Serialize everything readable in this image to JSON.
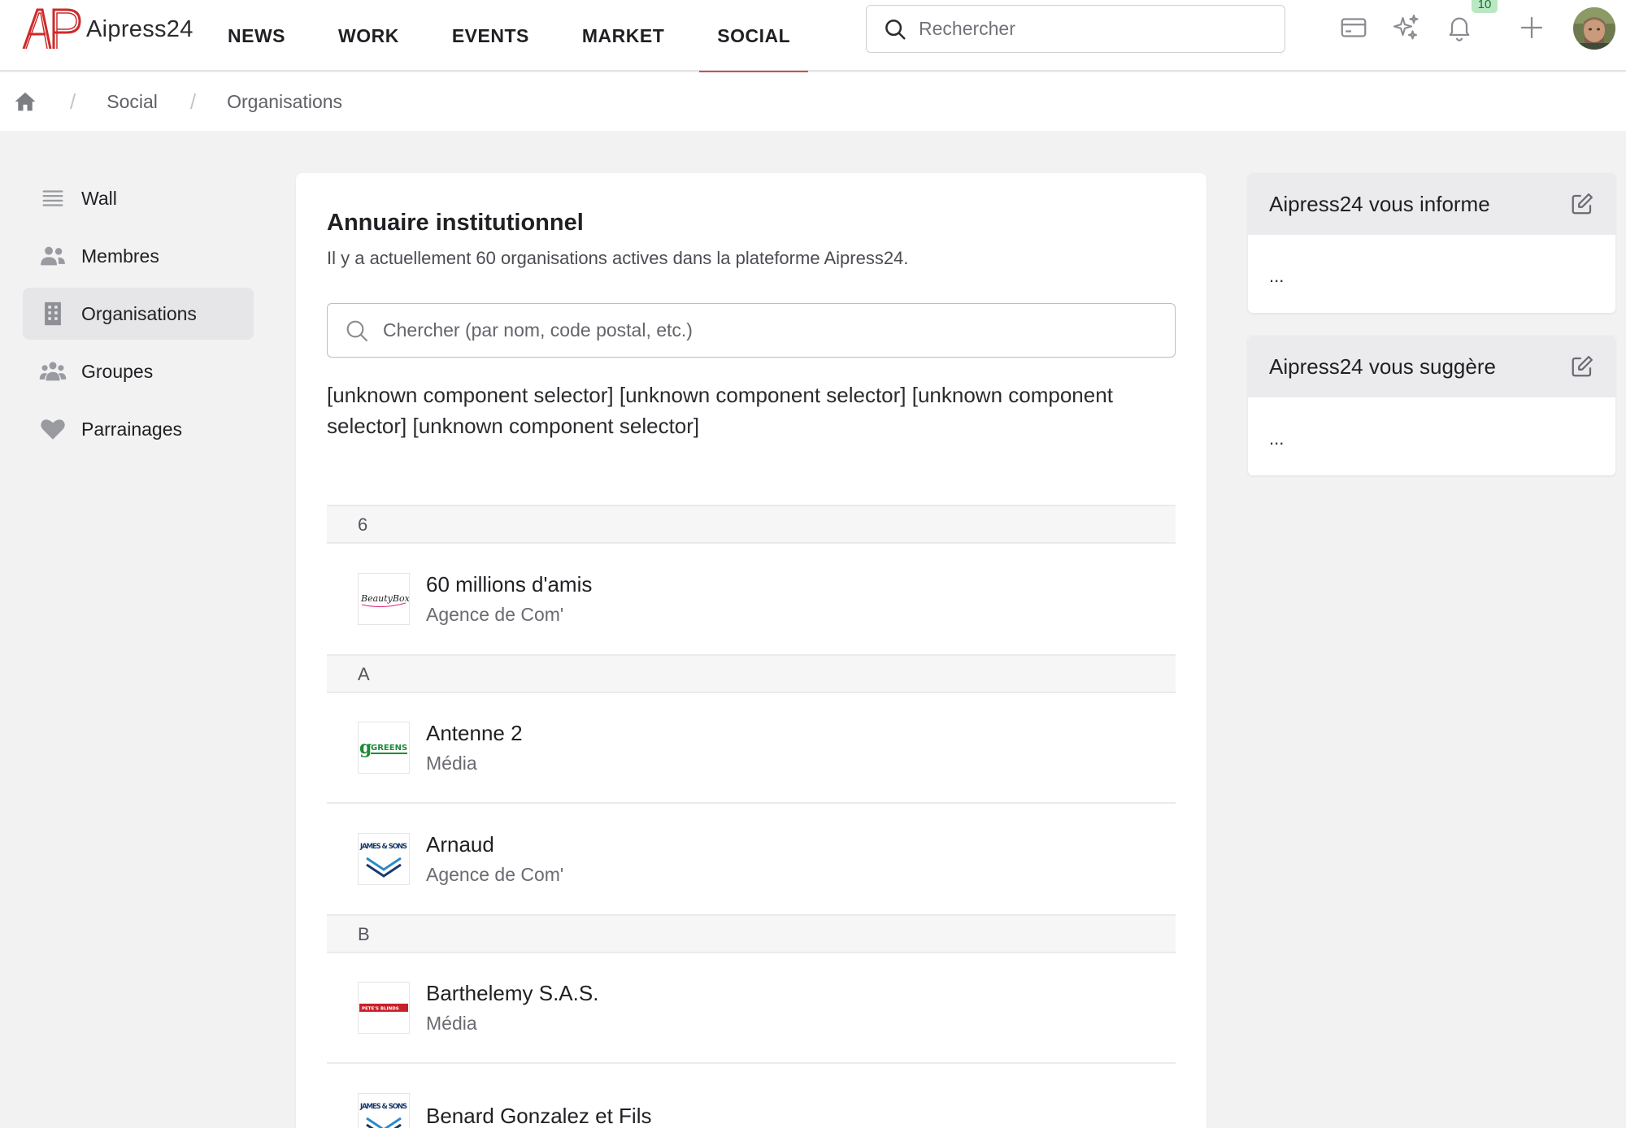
{
  "app": {
    "name": "Aipress24",
    "logo_text": "AP"
  },
  "nav": [
    {
      "label": "NEWS"
    },
    {
      "label": "WORK"
    },
    {
      "label": "EVENTS"
    },
    {
      "label": "MARKET"
    },
    {
      "label": "SOCIAL",
      "active": true
    }
  ],
  "search": {
    "placeholder": "Rechercher"
  },
  "notifications": {
    "count": "10"
  },
  "icons": {
    "search": "search-icon",
    "card": "card-icon",
    "sparkles": "sparkles-icon",
    "bell": "bell-icon",
    "plus": "plus-icon",
    "home": "home-icon",
    "edit": "edit-icon"
  },
  "colors": {
    "accent": "#d84b4b",
    "badge_bg": "#b9e8c3",
    "sidebar_active": "#e6e6e8"
  },
  "breadcrumb": {
    "separator": "/",
    "items": [
      "Social",
      "Organisations"
    ]
  },
  "sidebar": {
    "items": [
      {
        "label": "Wall",
        "icon": "list-icon"
      },
      {
        "label": "Membres",
        "icon": "users-icon"
      },
      {
        "label": "Organisations",
        "icon": "building-icon",
        "active": true
      },
      {
        "label": "Groupes",
        "icon": "group-icon"
      },
      {
        "label": "Parrainages",
        "icon": "heart-icon"
      }
    ]
  },
  "main": {
    "title": "Annuaire institutionnel",
    "subtitle": "Il y a actuellement 60 organisations actives dans la plateforme Aipress24.",
    "search_placeholder": "Chercher (par nom, code postal, etc.)",
    "unknown_text": "[unknown component selector] [unknown component selector] [unknown component selector] [unknown component selector]",
    "groups": [
      {
        "letter": "6",
        "orgs": [
          {
            "name": "60 millions d'amis",
            "type": "Agence de Com'",
            "logo_text": "BeautyBox"
          }
        ]
      },
      {
        "letter": "A",
        "orgs": [
          {
            "name": "Antenne 2",
            "type": "Média",
            "logo_text": "GREENS"
          },
          {
            "name": "Arnaud",
            "type": "Agence de Com'",
            "logo_text": "JAMES & SONS"
          }
        ]
      },
      {
        "letter": "B",
        "orgs": [
          {
            "name": "Barthelemy S.A.S.",
            "type": "Média",
            "logo_text": "PETE'S BLINDS"
          },
          {
            "name": "Benard Gonzalez et Fils",
            "type": "",
            "logo_text": "JAMES & SONS"
          }
        ]
      }
    ]
  },
  "widgets": [
    {
      "title": "Aipress24 vous informe",
      "body": "..."
    },
    {
      "title": "Aipress24 vous suggère",
      "body": "..."
    }
  ]
}
